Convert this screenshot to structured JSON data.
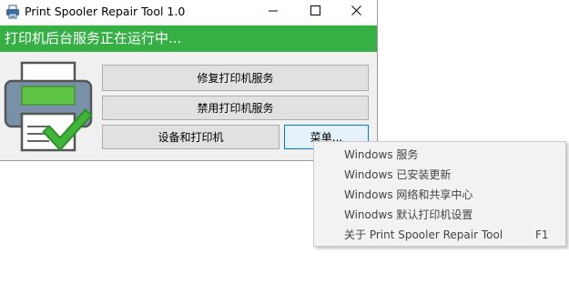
{
  "window": {
    "title": "Print Spooler Repair Tool 1.0",
    "status_text": "打印机后台服务正在运行中...",
    "status_color": "#36b045"
  },
  "icons": {
    "app": "printer-icon",
    "minimize": "minimize-icon",
    "maximize": "maximize-icon",
    "close": "close-icon",
    "illustration": "printer-check-illustration"
  },
  "buttons": {
    "repair": "修复打印机服务",
    "disable": "禁用打印机服务",
    "devices": "设备和打印机",
    "menu": "菜单..."
  },
  "context_menu": {
    "items": [
      {
        "label": "Windows 服务",
        "shortcut": ""
      },
      {
        "label": "Windows 已安装更新",
        "shortcut": ""
      },
      {
        "label": "Windows 网络和共享中心",
        "shortcut": ""
      },
      {
        "label": "Winodws 默认打印机设置",
        "shortcut": ""
      },
      {
        "label": "关于 Print Spooler Repair Tool",
        "shortcut": "F1"
      }
    ]
  }
}
